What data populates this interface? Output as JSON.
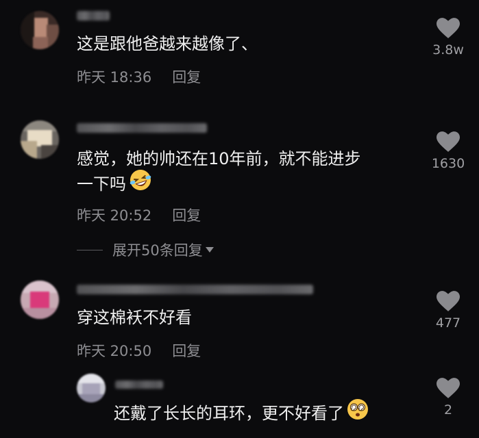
{
  "comments": [
    {
      "text": "这是跟他爸越来越像了、",
      "time": "昨天 18:36",
      "reply_label": "回复",
      "like_count": "3.8w"
    },
    {
      "text_line1": "感觉，她的帅还在10年前，就不能进步",
      "text_line2": "一下吗",
      "emoji_icon": "laughing-tears-emoji-icon",
      "time": "昨天 20:52",
      "reply_label": "回复",
      "like_count": "1630",
      "expand_label": "展开50条回复"
    },
    {
      "text": "穿这棉袄不好看",
      "time": "昨天 20:50",
      "reply_label": "回复",
      "like_count": "477"
    }
  ],
  "sub_reply": {
    "text": "还戴了长长的耳环，更不好看了",
    "emoji_icon": "dizzy-face-emoji-icon",
    "like_count": "2"
  },
  "colors": {
    "background": "#0b0b0d",
    "text": "#efefef",
    "meta": "#8e8e92",
    "like_heart": "#8a8a8e"
  },
  "icons": {
    "like": "heart-icon",
    "expand_caret": "caret-down-icon"
  }
}
